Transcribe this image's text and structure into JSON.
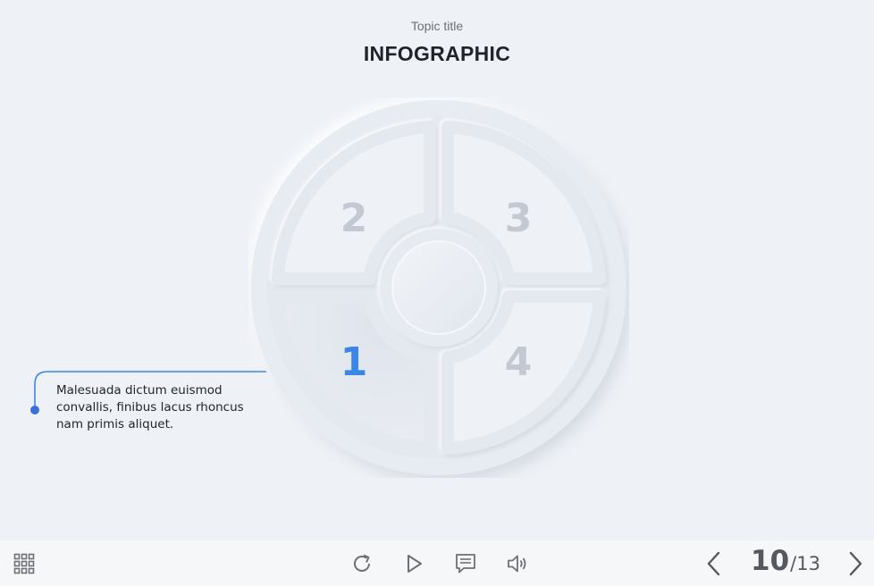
{
  "header": {
    "subtitle": "Topic title",
    "title": "INFOGRAPHIC"
  },
  "wheel": {
    "segments": [
      {
        "label": "1",
        "active": true
      },
      {
        "label": "2",
        "active": false
      },
      {
        "label": "3",
        "active": false
      },
      {
        "label": "4",
        "active": false
      }
    ]
  },
  "callout": {
    "text": "Malesuada dictum euismod convallis, finibus lacus rhoncus nam primis aliquet."
  },
  "toolbar": {
    "menu_icon": "grid-menu-icon",
    "replay_icon": "replay-icon",
    "play_icon": "play-icon",
    "notes_icon": "notes-icon",
    "audio_icon": "speaker-icon",
    "prev_icon": "chevron-left-icon",
    "next_icon": "chevron-right-icon",
    "current_page": "10",
    "total_pages": "/13"
  },
  "colors": {
    "accent": "#3d86e6",
    "inactive_number": "#c4c8d2",
    "background": "#eef1f6",
    "toolbar_bg": "#f6f7f8"
  }
}
